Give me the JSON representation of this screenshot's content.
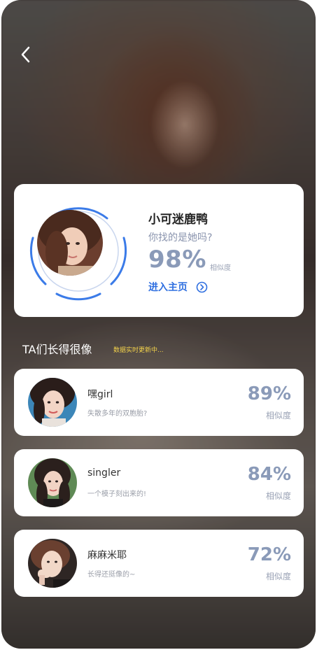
{
  "main": {
    "name": "小可迷鹿鸭",
    "question": "你找的是她吗?",
    "percent": "98%",
    "similarity_label": "相似度",
    "enter_home_label": "进入主页"
  },
  "section": {
    "title": "TA们长得很像",
    "subtitle": "数据实时更新中..."
  },
  "matches": [
    {
      "name": "嘿girl",
      "desc": "失散多年的双胞胎?",
      "percent": "89%",
      "similarity_label": "相似度"
    },
    {
      "name": "singler",
      "desc": "一个模子刻出来的!",
      "percent": "84%",
      "similarity_label": "相似度"
    },
    {
      "name": "麻麻米耶",
      "desc": "长得还挺像的~",
      "percent": "72%",
      "similarity_label": "相似度"
    }
  ],
  "colors": {
    "accent": "#2f6fe0",
    "percent": "#8a9ab8",
    "highlight": "#f2d24b"
  },
  "icons": {
    "back": "chevron-left-icon",
    "enter": "chevron-right-circle-icon"
  }
}
